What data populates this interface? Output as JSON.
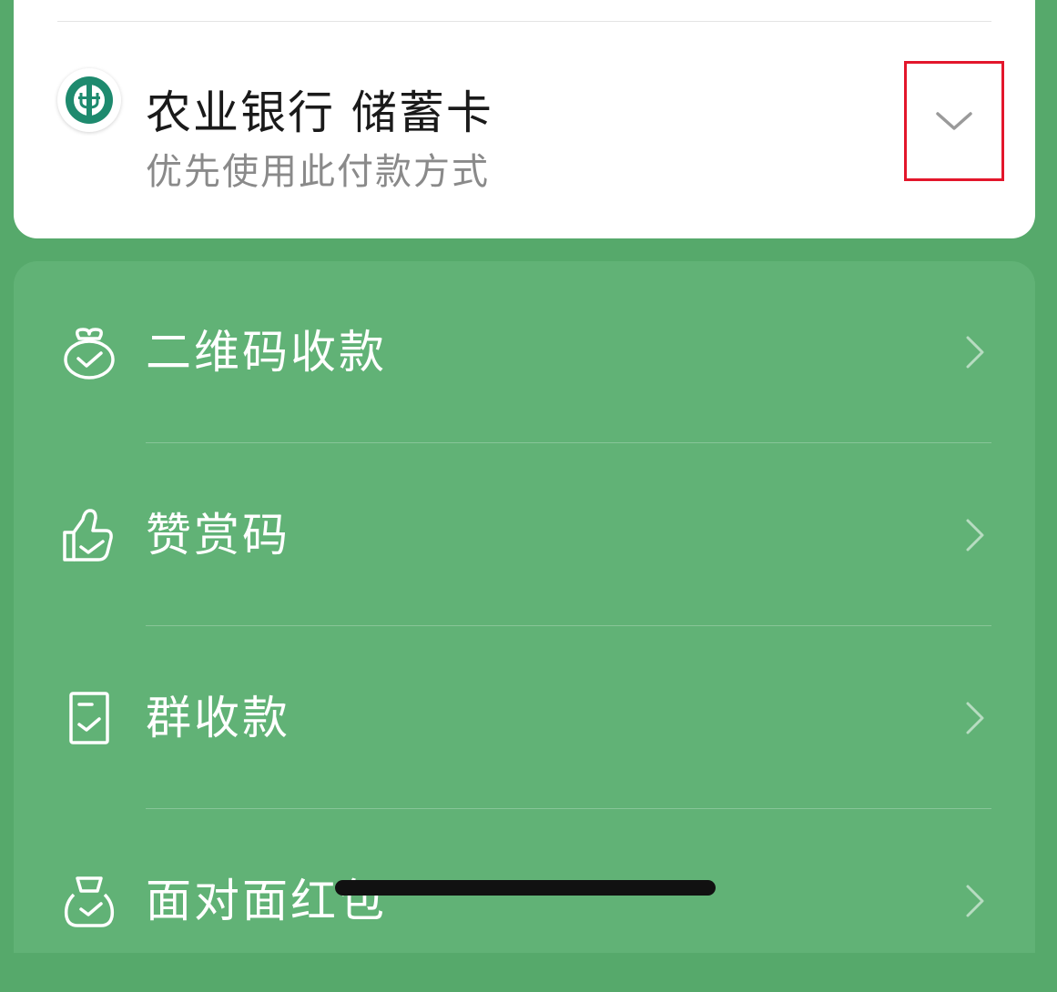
{
  "payment": {
    "bank_name": "农业银行 储蓄卡",
    "subtitle": "优先使用此付款方式",
    "highlight_color": "#e3162b"
  },
  "menu": {
    "items": [
      {
        "label": "二维码收款",
        "icon": "money-bag-icon"
      },
      {
        "label": "赞赏码",
        "icon": "thumbs-up-icon"
      },
      {
        "label": "群收款",
        "icon": "receipt-icon"
      },
      {
        "label": "面对面红包",
        "icon": "red-packet-icon"
      }
    ]
  },
  "colors": {
    "background": "#56a96b",
    "panel": "#61b276",
    "bank_logo": "#1e8a6e"
  }
}
